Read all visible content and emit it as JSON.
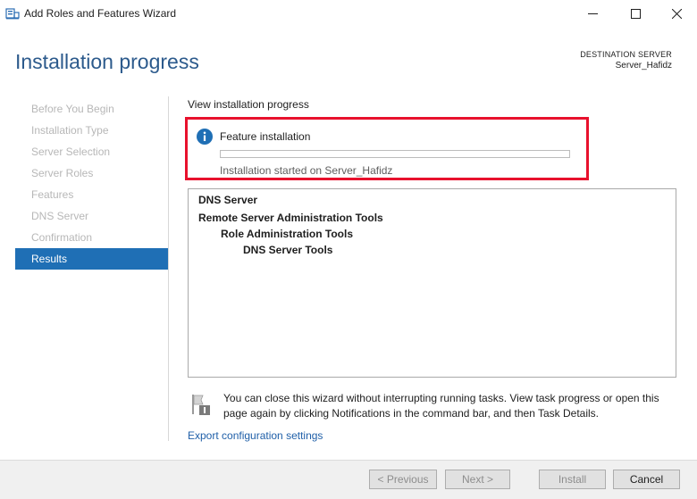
{
  "window": {
    "title": "Add Roles and Features Wizard",
    "icon": "server-manager-icon"
  },
  "page": {
    "title": "Installation progress",
    "destination_label": "DESTINATION SERVER",
    "destination_value": "Server_Hafidz"
  },
  "nav": {
    "items": [
      {
        "label": "Before You Begin",
        "active": false
      },
      {
        "label": "Installation Type",
        "active": false
      },
      {
        "label": "Server Selection",
        "active": false
      },
      {
        "label": "Server Roles",
        "active": false
      },
      {
        "label": "Features",
        "active": false
      },
      {
        "label": "DNS Server",
        "active": false
      },
      {
        "label": "Confirmation",
        "active": false
      },
      {
        "label": "Results",
        "active": true
      }
    ]
  },
  "main": {
    "heading": "View installation progress",
    "status": {
      "icon": "info-icon",
      "title": "Feature installation",
      "progress": 0,
      "subtitle": "Installation started on Server_Hafidz"
    },
    "results": [
      {
        "label": "DNS Server",
        "level": 0
      },
      {
        "label": "Remote Server Administration Tools",
        "level": 0
      },
      {
        "label": "Role Administration Tools",
        "level": 1
      },
      {
        "label": "DNS Server Tools",
        "level": 2
      }
    ],
    "note": "You can close this wizard without interrupting running tasks. View task progress or open this page again by clicking Notifications in the command bar, and then Task Details.",
    "note_icon": "flag-notification-icon",
    "export_link": "Export configuration settings"
  },
  "footer": {
    "previous": "< Previous",
    "next": "Next >",
    "install": "Install",
    "cancel": "Cancel"
  },
  "colors": {
    "accent": "#1f6fb5",
    "title": "#2c5a8c",
    "highlight": "#e8112d",
    "link": "#1f5fa8"
  }
}
